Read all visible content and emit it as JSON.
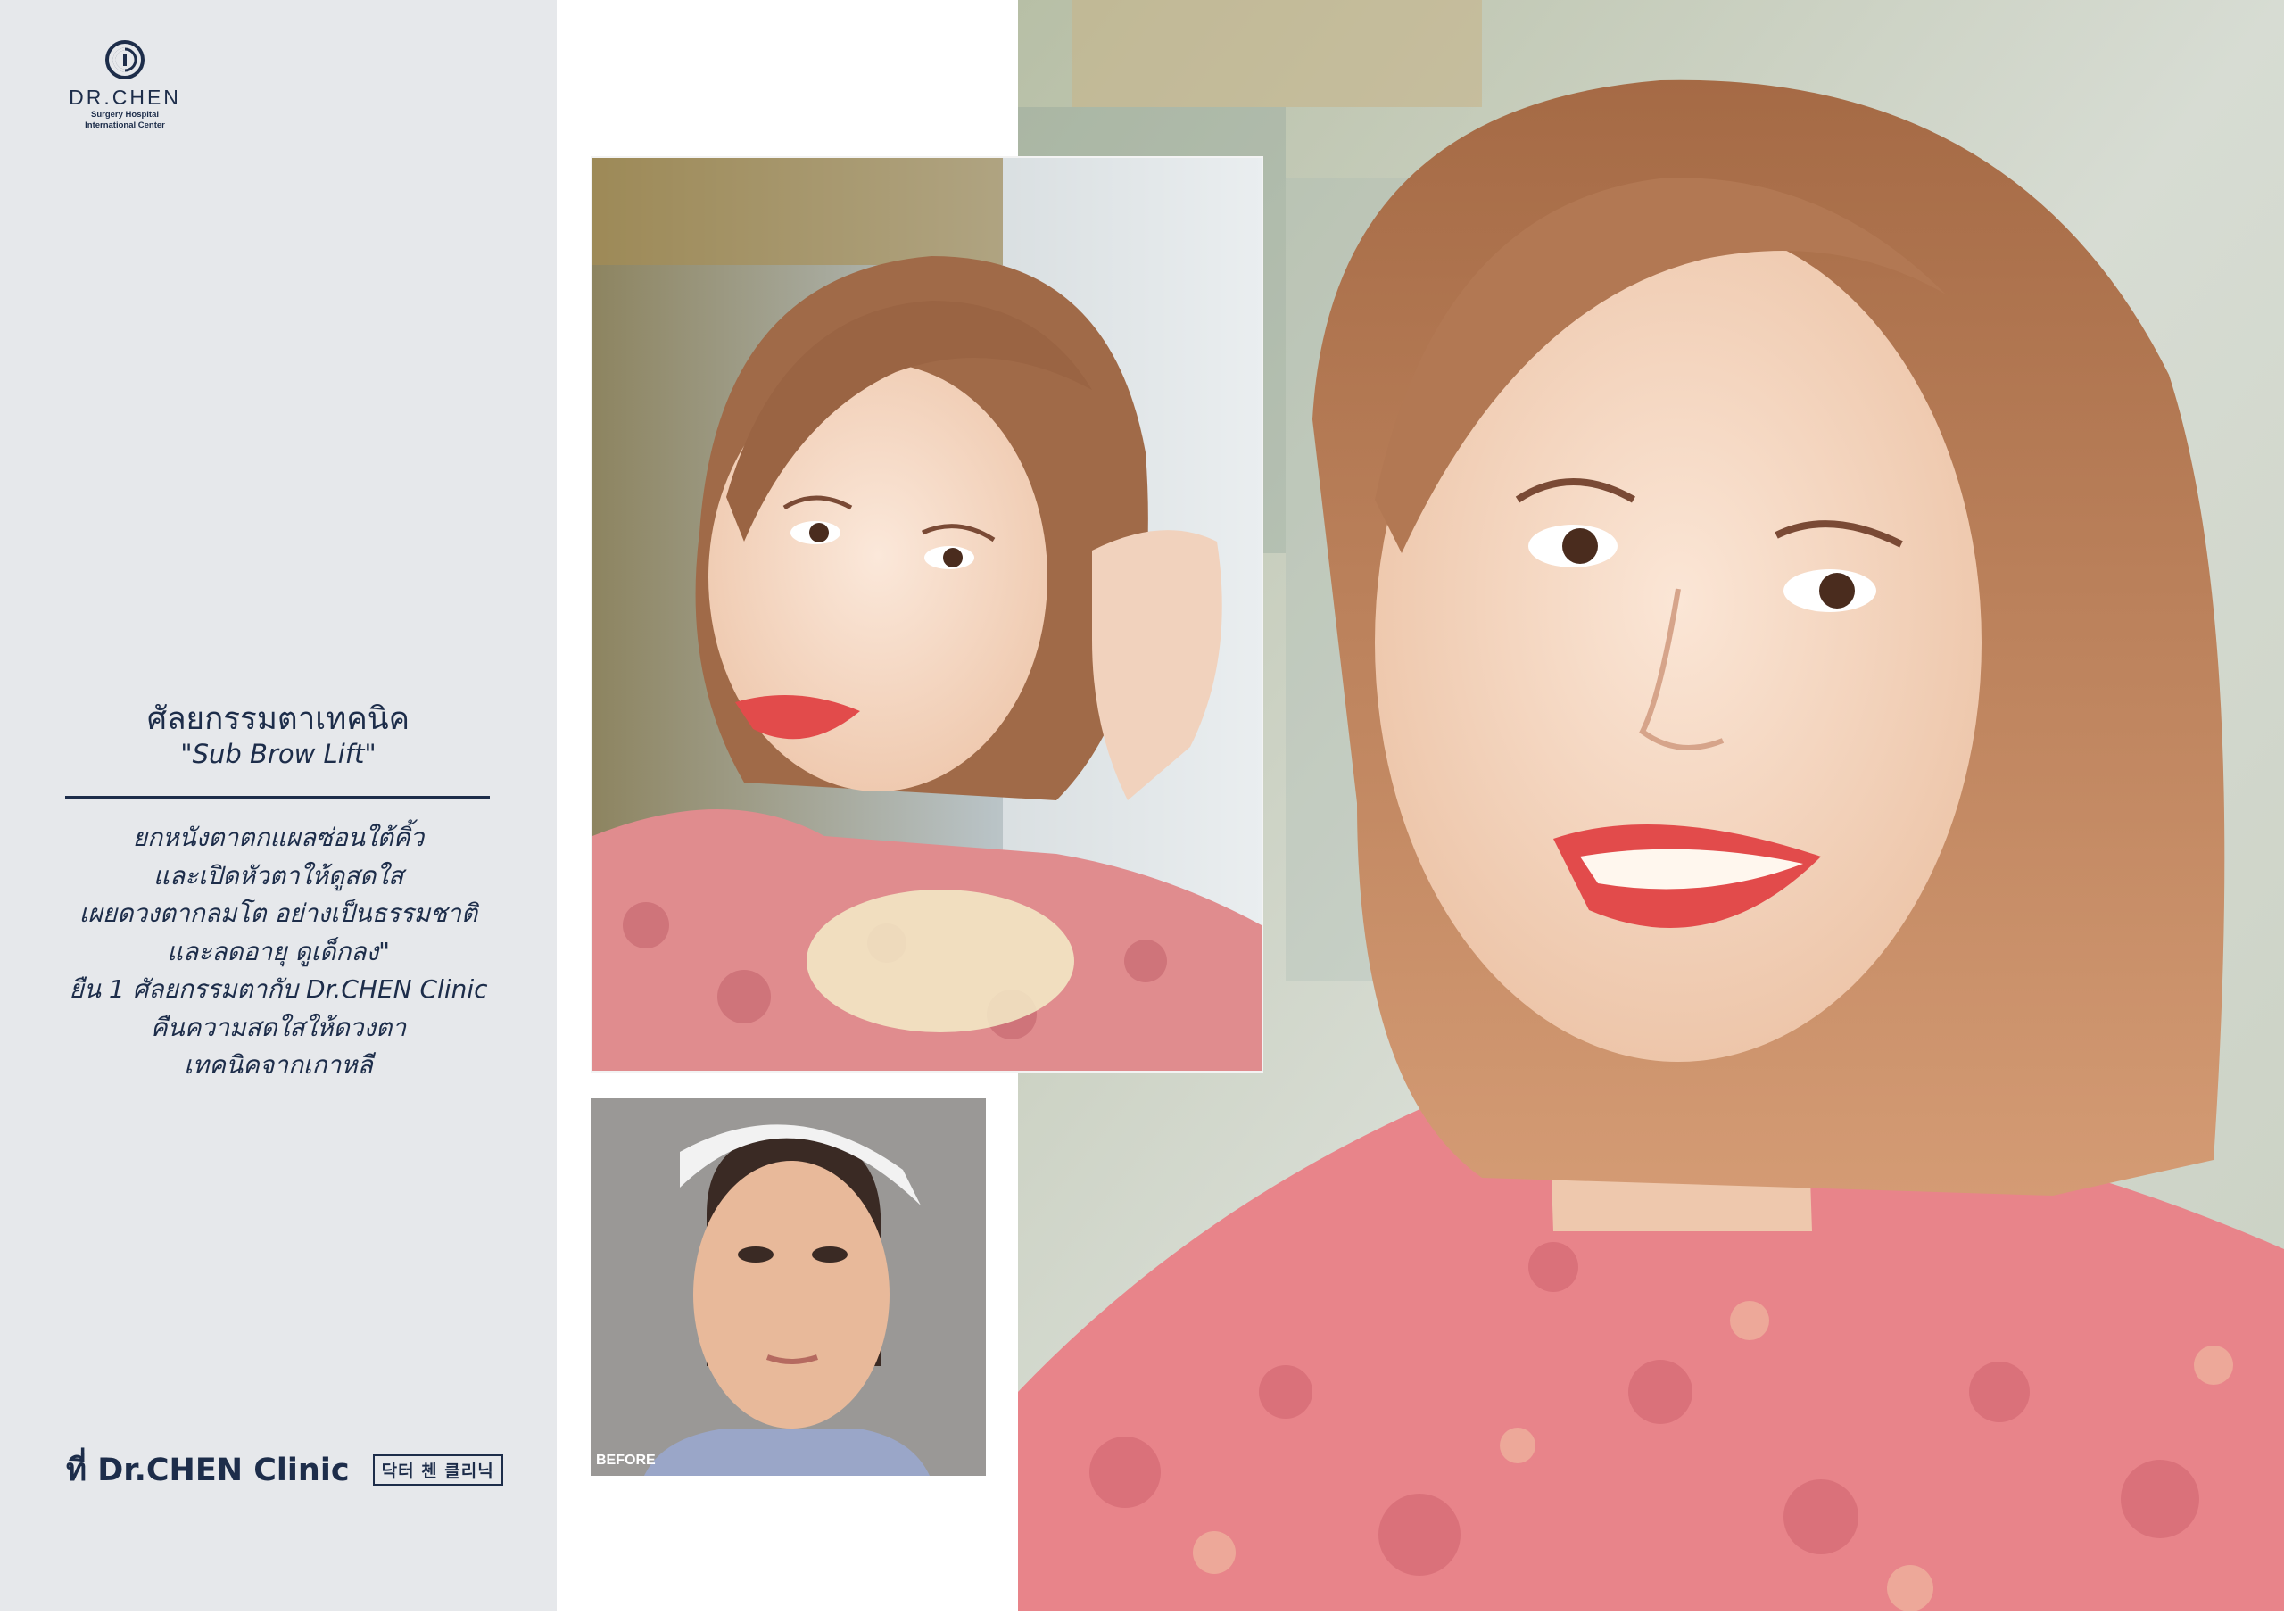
{
  "brand": {
    "name": "DR.CHEN",
    "line1": "Surgery Hospital",
    "line2": "International Center"
  },
  "content": {
    "headline": "ศัลยกรรมตาเทคนิค",
    "subheadline": "\"Sub Brow Lift\"",
    "description_lines": [
      "ยกหนังตาตกแผลซ่อนใต้คิ้ว",
      "และเปิดหัวตาให้ดูสดใส",
      "เผยดวงตากลมโต อย่างเป็นธรรมชาติ",
      "และลดอายุ ดูเด็กลง\"",
      "ยืน 1 ศัลยกรรมตากับ Dr.CHEN Clinic",
      "คืนความสดใสให้ดวงตา",
      "เทคนิคจากเกาหลี"
    ]
  },
  "footer": {
    "clinic_name": "ที่ Dr.CHEN Clinic",
    "clinic_korean": "닥터 첸 클리닉"
  },
  "photos": {
    "before_label": "BEFORE"
  },
  "colors": {
    "navy": "#1d2d4a",
    "panel_bg": "#e6e8eb",
    "shirt_pink": "#e8848a",
    "hair": "#b57a55",
    "skin": "#f3d5bf",
    "lips": "#e24b4b"
  }
}
